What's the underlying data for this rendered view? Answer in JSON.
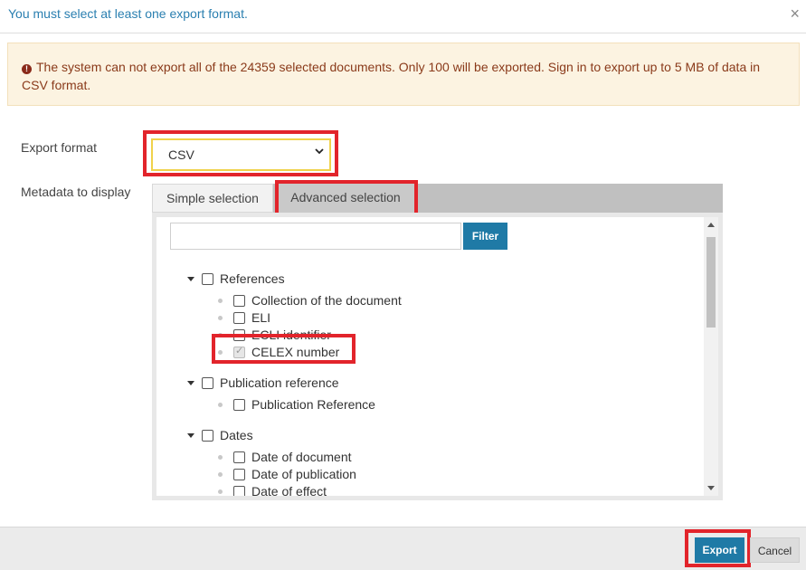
{
  "header": {
    "title": "You must select at least one export format.",
    "close_glyph": "×"
  },
  "alert": {
    "icon": "!",
    "message": "The system can not export all of the 24359 selected documents. Only 100 will be exported. Sign in to export up to 5 MB of data in CSV format."
  },
  "form": {
    "export_format_label": "Export format",
    "export_format_value": "CSV",
    "metadata_label": "Metadata to display"
  },
  "tabs": {
    "simple": "Simple selection",
    "advanced": "Advanced selection"
  },
  "filter": {
    "button": "Filter",
    "value": ""
  },
  "tree": {
    "references": "References",
    "collection": "Collection of the document",
    "eli": "ELI",
    "ecli": "ECLI identifier",
    "celex": "CELEX number",
    "publication_reference_group": "Publication reference",
    "publication_reference_item": "Publication Reference",
    "dates": "Dates",
    "date_document": "Date of document",
    "date_publication": "Date of publication",
    "date_effect": "Date of effect"
  },
  "footer": {
    "export": "Export",
    "cancel": "Cancel"
  },
  "colors": {
    "accent": "#1f7aa6",
    "highlight": "#e2242b",
    "alert_bg": "#fcf3e1"
  }
}
